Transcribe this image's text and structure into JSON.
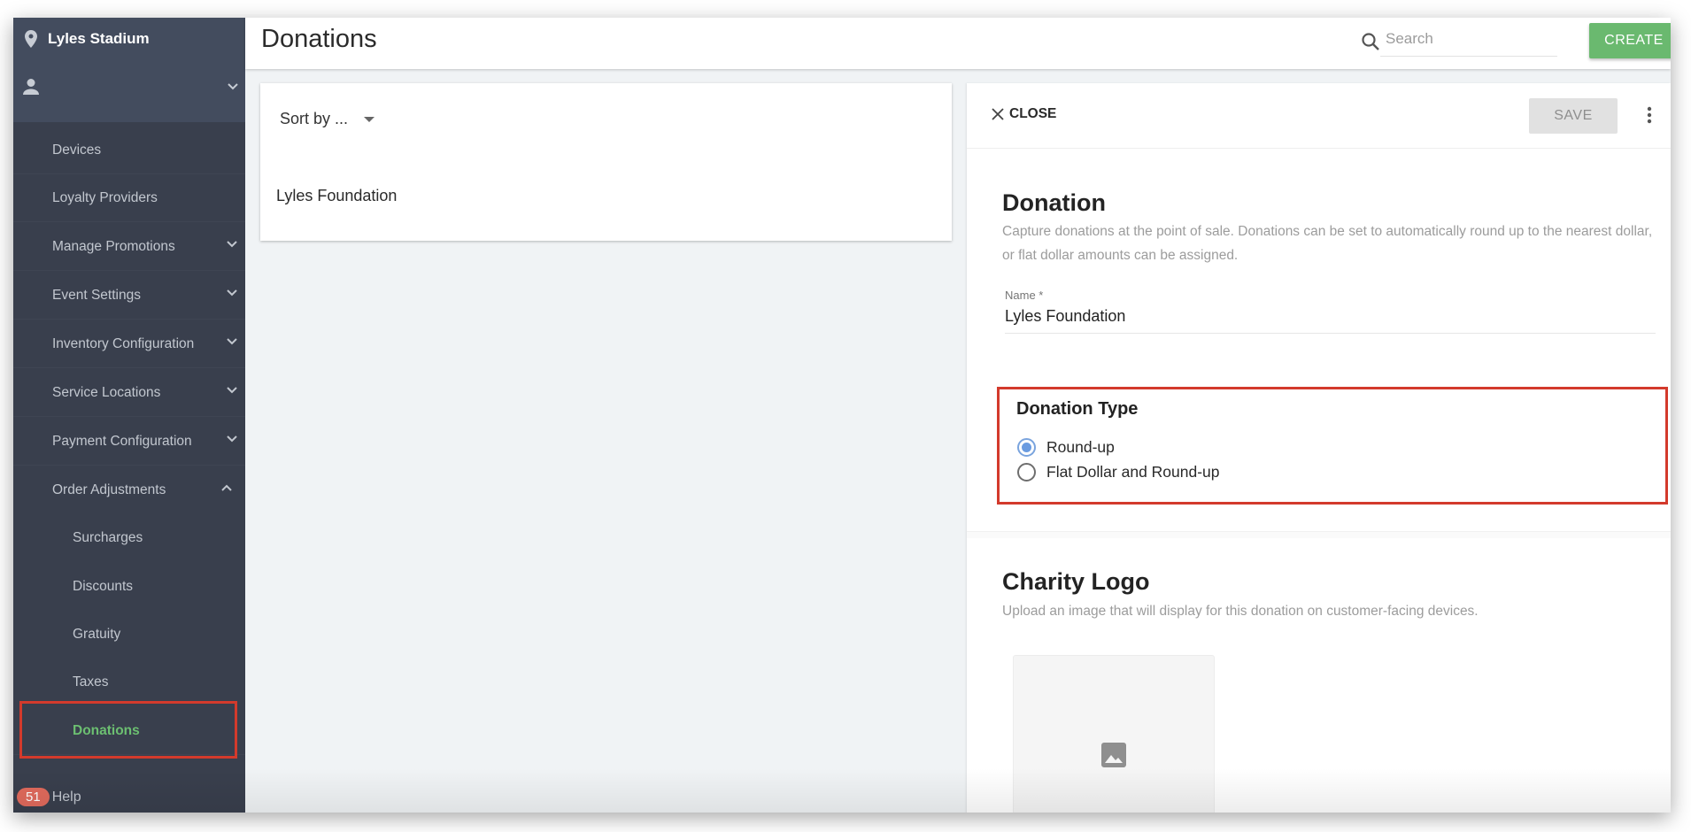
{
  "sidebar": {
    "venue": "Lyles Stadium",
    "items": [
      {
        "label": "Devices",
        "expandable": false
      },
      {
        "label": "Loyalty Providers",
        "expandable": false
      },
      {
        "label": "Manage Promotions",
        "expandable": true
      },
      {
        "label": "Event Settings",
        "expandable": true
      },
      {
        "label": "Inventory Configuration",
        "expandable": true
      },
      {
        "label": "Service Locations",
        "expandable": true
      },
      {
        "label": "Payment Configuration",
        "expandable": true
      },
      {
        "label": "Order Adjustments",
        "expandable": true,
        "expanded": true
      }
    ],
    "sub_items": [
      {
        "label": "Surcharges"
      },
      {
        "label": "Discounts"
      },
      {
        "label": "Gratuity"
      },
      {
        "label": "Taxes"
      },
      {
        "label": "Donations",
        "active": true
      }
    ],
    "help": {
      "badge": "51",
      "label": "Help"
    }
  },
  "header": {
    "title": "Donations",
    "search_placeholder": "Search",
    "create_label": "CREATE"
  },
  "list": {
    "sort_label": "Sort by ...",
    "items": [
      "Lyles Foundation"
    ]
  },
  "detail": {
    "close_label": "CLOSE",
    "save_label": "SAVE",
    "donation": {
      "title": "Donation",
      "description": "Capture donations at the point of sale. Donations can be set to automatically round up to the nearest dollar, or flat dollar amounts can be assigned.",
      "name_label": "Name *",
      "name_value": "Lyles Foundation"
    },
    "donation_type": {
      "title": "Donation Type",
      "options": [
        {
          "label": "Round-up",
          "selected": true
        },
        {
          "label": "Flat Dollar and Round-up",
          "selected": false
        }
      ]
    },
    "charity_logo": {
      "title": "Charity Logo",
      "description": "Upload an image that will display for this donation on customer-facing devices."
    }
  },
  "colors": {
    "sidebar_bg": "#393f4d",
    "sidebar_header_bg": "#434c5e",
    "accent_green": "#6ab96f",
    "active_green": "#6cbf71",
    "highlight_red": "#d33a2c",
    "radio_blue": "#6a9be0",
    "badge_red": "#e06a5c"
  }
}
